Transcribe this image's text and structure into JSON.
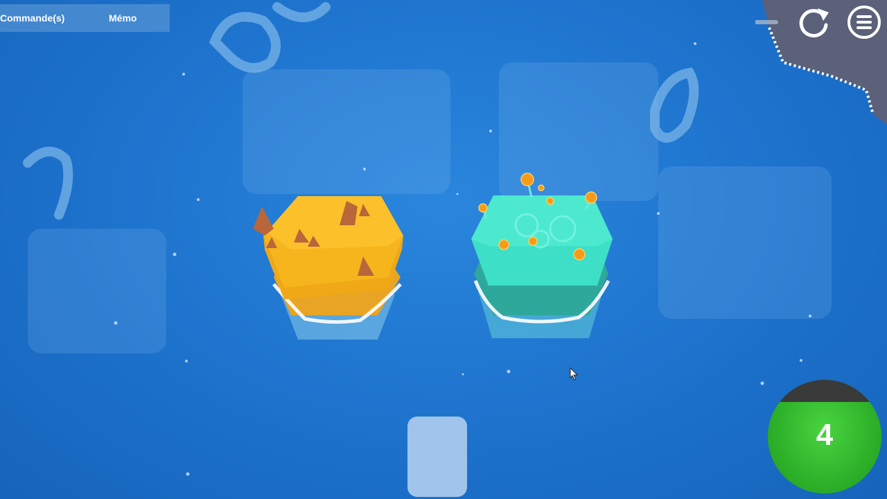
{
  "toolbar": {
    "commands_label": "Commande(s)",
    "memo_label": "Mémo"
  },
  "hud": {
    "counter_value": "4",
    "refresh_icon": "refresh-icon",
    "menu_icon": "menu-icon"
  },
  "tiles": [
    {
      "kind": "desert",
      "color": "#f5b21d"
    },
    {
      "kind": "mushroom-forest",
      "color": "#3ee3c8"
    }
  ],
  "colors": {
    "water": "#1d72cc",
    "counter_green": "#2eb12a",
    "slot": "#a8c8ec"
  }
}
